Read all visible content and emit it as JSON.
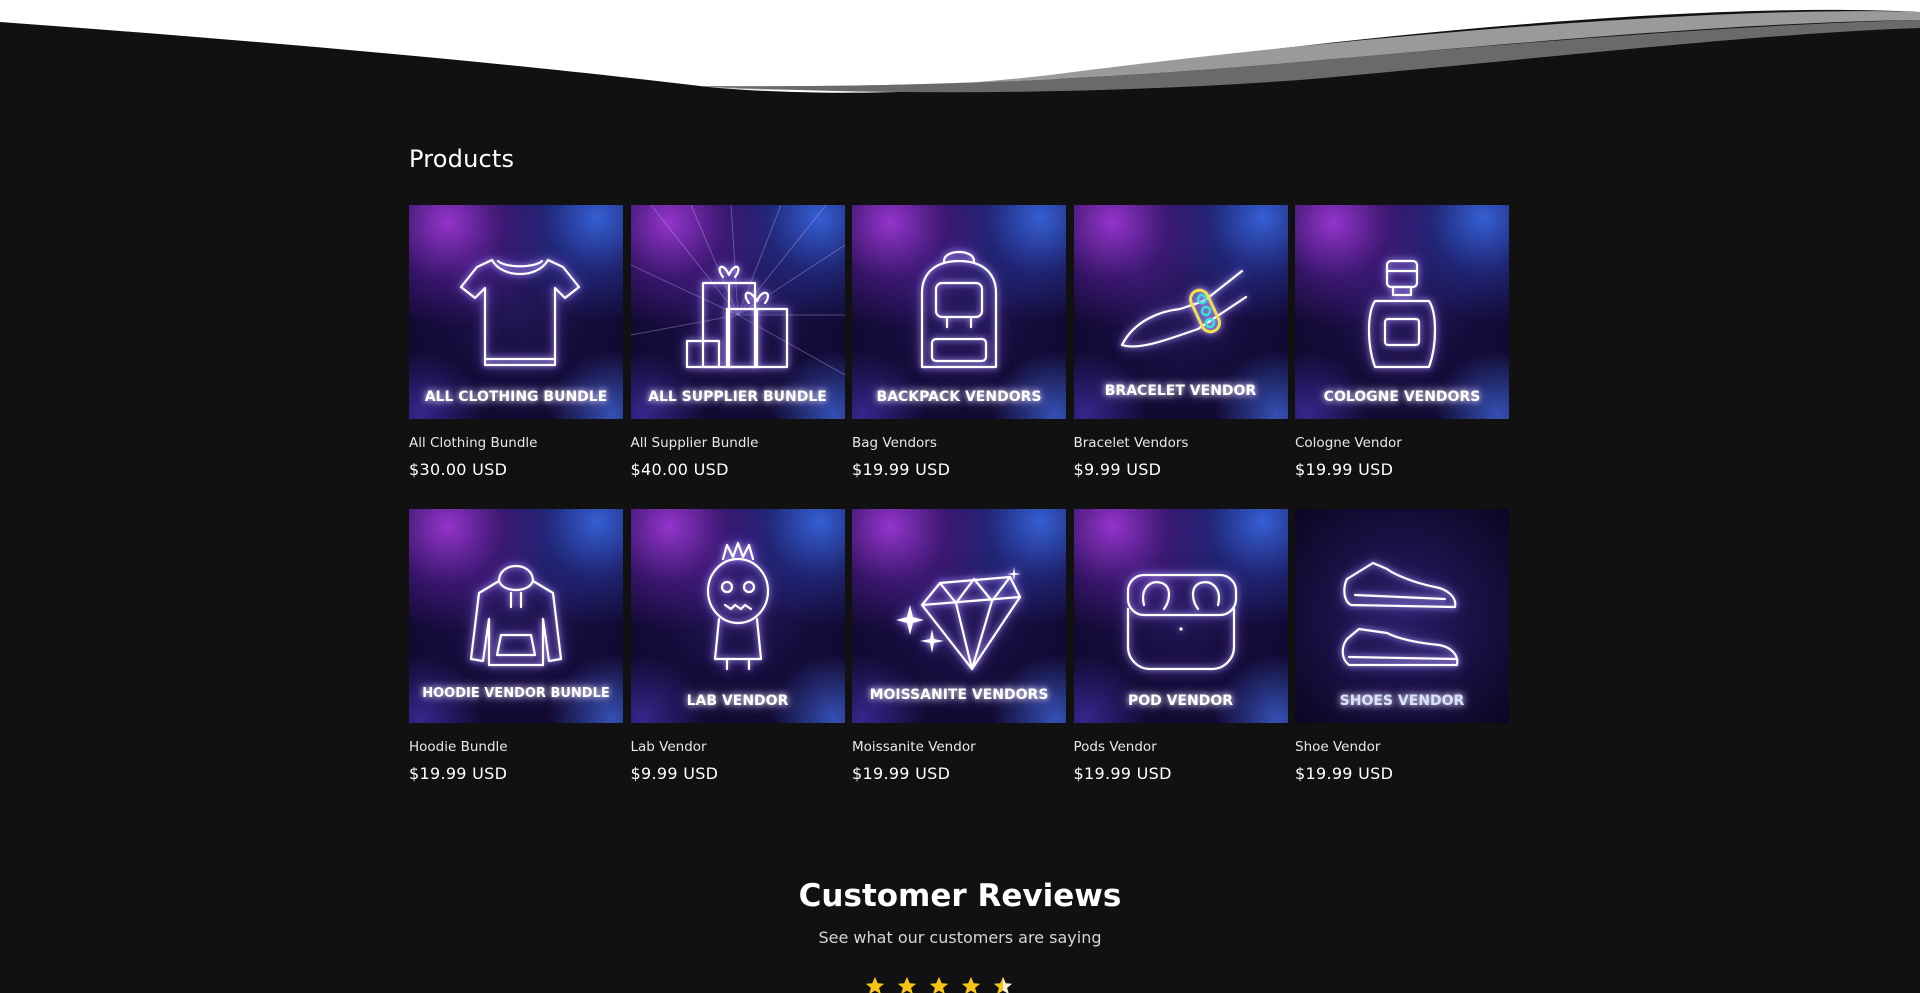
{
  "products_section": {
    "title": "Products",
    "items": [
      {
        "name": "All Clothing Bundle",
        "price": "$30.00 USD",
        "banner": "ALL CLOTHING BUNDLE",
        "icon": "tshirt-icon"
      },
      {
        "name": "All Supplier Bundle",
        "price": "$40.00 USD",
        "banner": "ALL SUPPLIER BUNDLE",
        "icon": "gift-boxes-icon"
      },
      {
        "name": "Bag Vendors",
        "price": "$19.99 USD",
        "banner": "BACKPACK VENDORS",
        "icon": "backpack-icon"
      },
      {
        "name": "Bracelet Vendors",
        "price": "$9.99 USD",
        "banner": "BRACELET VENDOR",
        "icon": "bracelet-hand-icon"
      },
      {
        "name": "Cologne Vendor",
        "price": "$19.99 USD",
        "banner": "COLOGNE VENDORS",
        "icon": "cologne-bottle-icon"
      },
      {
        "name": "Hoodie Bundle",
        "price": "$19.99 USD",
        "banner": "HOODIE VENDOR BUNDLE",
        "icon": "hoodie-icon"
      },
      {
        "name": "Lab Vendor",
        "price": "$9.99 USD",
        "banner": "LAB VENDOR",
        "icon": "labubu-figure-icon"
      },
      {
        "name": "Moissanite Vendor",
        "price": "$19.99 USD",
        "banner": "MOISSANITE VENDORS",
        "icon": "diamond-icon"
      },
      {
        "name": "Pods Vendor",
        "price": "$19.99 USD",
        "banner": "POD VENDOR",
        "icon": "earbuds-case-icon"
      },
      {
        "name": "Shoe Vendor",
        "price": "$19.99 USD",
        "banner": "SHOES VENDOR",
        "icon": "sneakers-icon"
      }
    ]
  },
  "reviews_section": {
    "title": "Customer Reviews",
    "subtitle": "See what our customers are saying",
    "rating": 4.5
  },
  "colors": {
    "background": "#111111",
    "text": "#ffffff",
    "star": "#f5c518",
    "wave_light": "#ffffff",
    "wave_shadow": "#8c8c8c"
  }
}
